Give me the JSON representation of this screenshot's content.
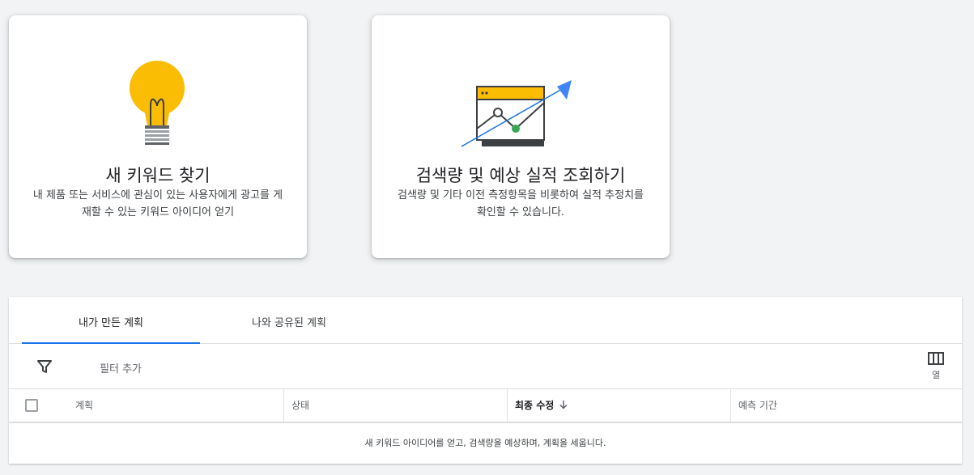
{
  "cards": {
    "discover": {
      "title": "새 키워드 찾기",
      "description": "내 제품 또는 서비스에 관심이 있는 사용자에게 광고를 게재할 수 있는 키워드 아이디어 얻기",
      "icon": "lightbulb-icon"
    },
    "forecast": {
      "title": "검색량 및 예상 실적 조회하기",
      "description": "검색량 및 기타 이전 측정항목을 비롯하여 실적 추정치를 확인할 수 있습니다.",
      "icon": "trend-chart-icon"
    }
  },
  "tabs": [
    {
      "label": "내가 만든 계획",
      "active": true
    },
    {
      "label": "나와 공유된 계획",
      "active": false
    }
  ],
  "filter": {
    "label": "필터 추가",
    "icon": "filter-icon"
  },
  "columns_button": {
    "label": "열",
    "icon": "columns-icon"
  },
  "table": {
    "headers": {
      "plan": "계획",
      "status": "상태",
      "last_modified": "최종 수정",
      "forecast_period": "예측 기간"
    },
    "sorted_by": "last_modified",
    "empty_message": "새 키워드 아이디어를 얻고, 검색량을 예상하며, 계획을 세웁니다."
  },
  "colors": {
    "accent": "#1a73e8",
    "bulb": "#fbbc04",
    "chart_point": "#34a853"
  }
}
